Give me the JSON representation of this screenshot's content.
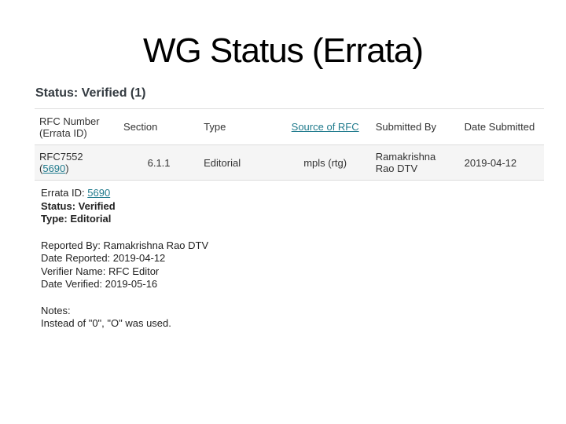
{
  "page": {
    "title": "WG Status (Errata)"
  },
  "status_heading": "Status: Verified (1)",
  "table": {
    "headers": {
      "rfc_number_line1": "RFC Number",
      "rfc_number_line2": "(Errata ID)",
      "section": "Section",
      "type": "Type",
      "source": "Source of RFC",
      "submitted_by": "Submitted By",
      "date_submitted": "Date Submitted"
    },
    "rows": [
      {
        "rfc": "RFC7552",
        "errata_open": "(",
        "errata_id": "5690",
        "errata_close": ")",
        "section": "6.1.1",
        "type": "Editorial",
        "source": "mpls (rtg)",
        "submitted_by": "Ramakrishna Rao DTV",
        "date_submitted": "2019-04-12"
      }
    ]
  },
  "details": {
    "errata_id_label": "Errata ID: ",
    "errata_id_link": "5690",
    "status": "Status: Verified",
    "type": "Type: Editorial",
    "reported_by": "Reported By: Ramakrishna Rao DTV",
    "date_reported": "Date Reported: 2019-04-12",
    "verifier_name": "Verifier Name: RFC Editor",
    "date_verified": "Date Verified: 2019-05-16",
    "notes_label": "Notes:",
    "notes_text": "Instead of \"0\", \"O\" was used."
  },
  "colors": {
    "link": "#1f7a8c",
    "row_background": "#f5f5f5",
    "border": "#dddddd"
  }
}
